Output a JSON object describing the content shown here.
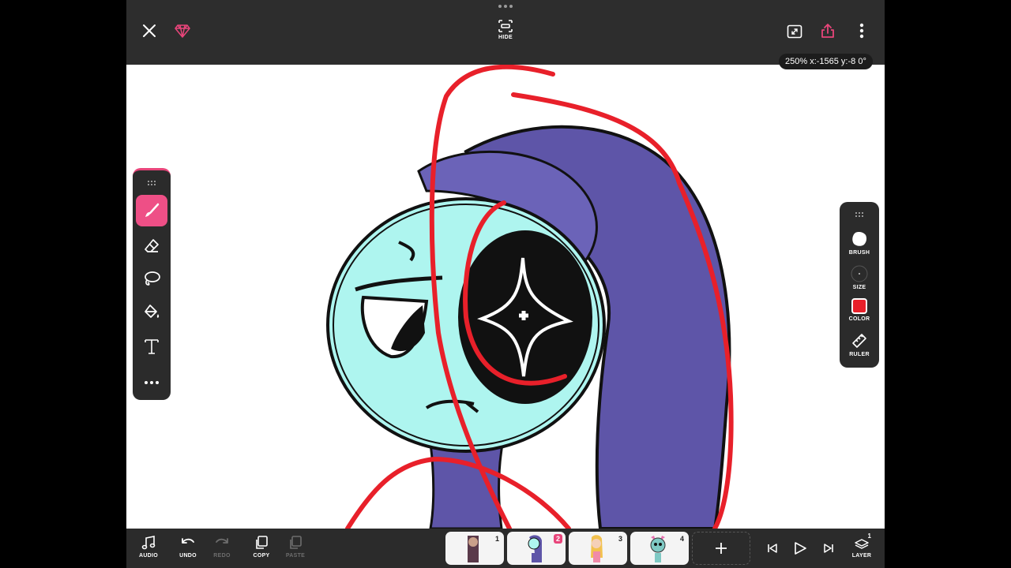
{
  "top": {
    "hide_label": "HIDE",
    "zoom_readout": "250% x:-1565 y:-8 0°"
  },
  "left_tools": [
    {
      "name": "brush",
      "active": true
    },
    {
      "name": "eraser",
      "active": false
    },
    {
      "name": "lasso",
      "active": false
    },
    {
      "name": "fill",
      "active": false
    },
    {
      "name": "text",
      "active": false
    },
    {
      "name": "more",
      "active": false
    }
  ],
  "right_panel": {
    "brush_label": "BRUSH",
    "size_label": "SIZE",
    "color_label": "COLOR",
    "ruler_label": "RULER",
    "current_color": "#e8202a"
  },
  "bottom": {
    "audio_label": "AUDIO",
    "undo_label": "UNDO",
    "redo_label": "REDO",
    "copy_label": "COPY",
    "paste_label": "PASTE",
    "layer_label": "LAYER",
    "layer_count": "1",
    "frames": [
      {
        "number": "1",
        "active": false
      },
      {
        "number": "2",
        "active": true
      },
      {
        "number": "3",
        "active": false
      },
      {
        "number": "4",
        "active": false
      }
    ]
  },
  "colors": {
    "accent": "#e8457a",
    "toolbar_bg": "#2b2b2b",
    "character_skin": "#aef5ef",
    "hair": "#5e55a8",
    "stroke_red": "#e8202a"
  }
}
